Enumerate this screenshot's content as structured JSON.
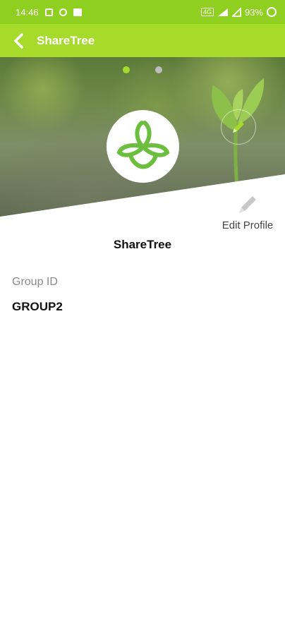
{
  "status_bar": {
    "time": "14:46",
    "battery": "93%",
    "icons": [
      "notification-icon",
      "chrome-icon",
      "image-icon",
      "volte-icon",
      "wifi-icon",
      "signal-icon",
      "battery-ring-icon"
    ]
  },
  "app_bar": {
    "title": "ShareTree",
    "back_icon": "chevron-left-icon"
  },
  "header": {
    "carousel_page_count": 2,
    "carousel_active_index": 0,
    "accent_color": "#a6db2b"
  },
  "profile": {
    "edit_label": "Edit Profile",
    "name": "ShareTree",
    "fields": [
      {
        "label": "Group ID",
        "value": "GROUP2"
      }
    ]
  },
  "colors": {
    "status_bar": "#8fcf1f",
    "app_bar": "#a6db2b",
    "logo": "#6cbf3e"
  }
}
